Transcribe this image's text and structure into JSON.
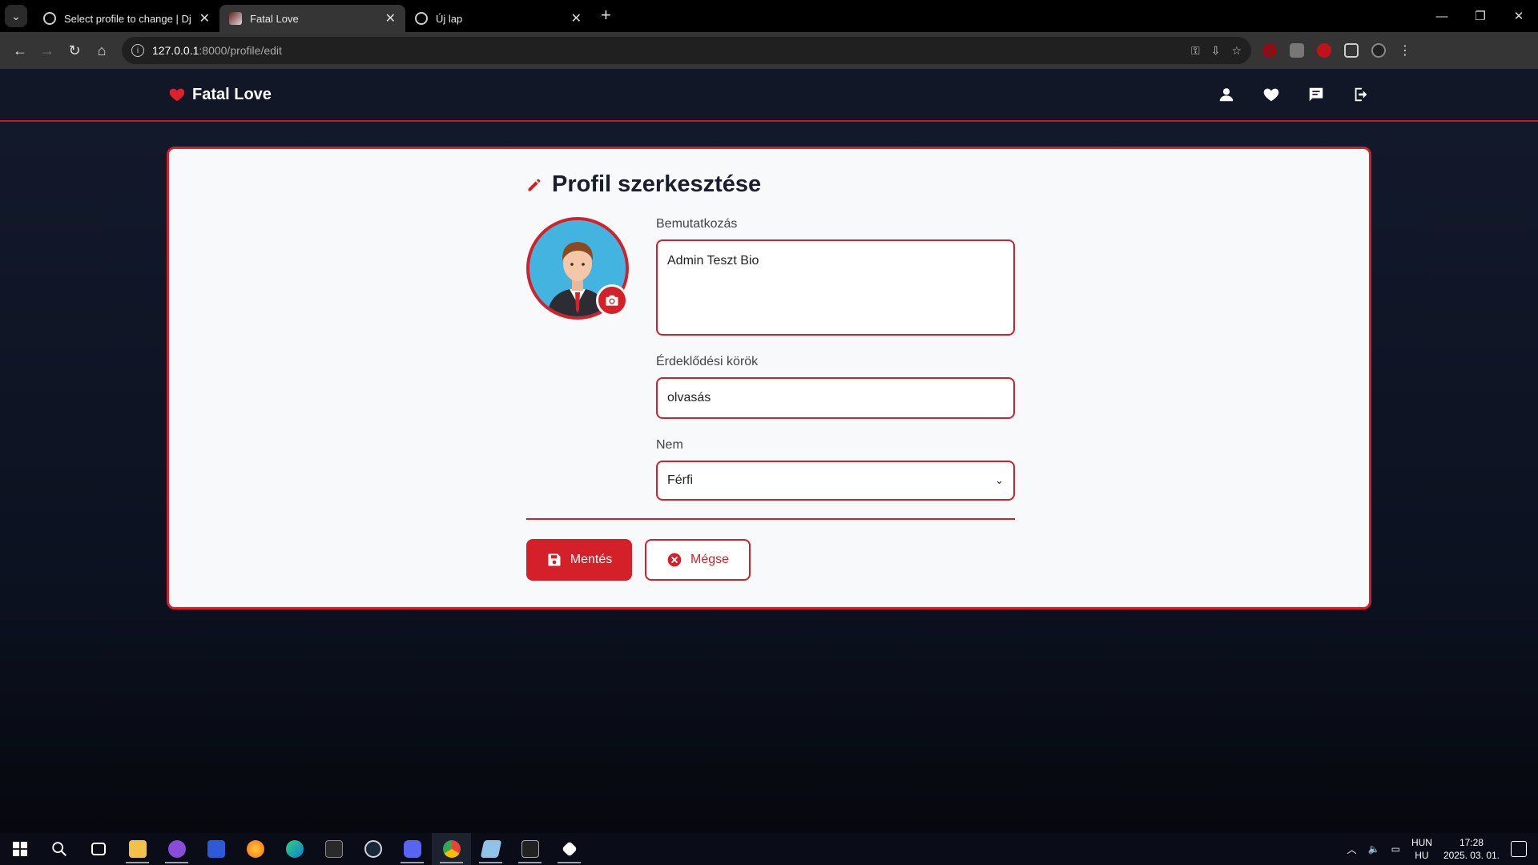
{
  "browser": {
    "tabs": [
      {
        "title": "Select profile to change | Djang",
        "active": false
      },
      {
        "title": "Fatal Love",
        "active": true
      },
      {
        "title": "Új lap",
        "active": false
      }
    ],
    "url_host": "127.0.0.1",
    "url_path": ":8000/profile/edit",
    "new_tab_symbol": "+",
    "window_controls": [
      "—",
      "❐",
      "✕"
    ]
  },
  "app": {
    "brand": "Fatal Love",
    "nav_icons": [
      "user-icon",
      "heart-icon",
      "messages-icon",
      "logout-icon"
    ]
  },
  "form": {
    "title": "Profil szerkesztése",
    "bio_label": "Bemutatkozás",
    "bio_value": "Admin Teszt Bio",
    "interests_label": "Érdeklődési körök",
    "interests_value": "olvasás",
    "gender_label": "Nem",
    "gender_value": "Férfi",
    "save_label": "Mentés",
    "cancel_label": "Mégse"
  },
  "taskbar": {
    "lang_top": "HUN",
    "lang_bottom": "HU",
    "time": "17:28",
    "date": "2025. 03. 01."
  },
  "colors": {
    "accent": "#d42028",
    "page_bg": "#0d1220",
    "card_bg": "#f8f9fb"
  }
}
